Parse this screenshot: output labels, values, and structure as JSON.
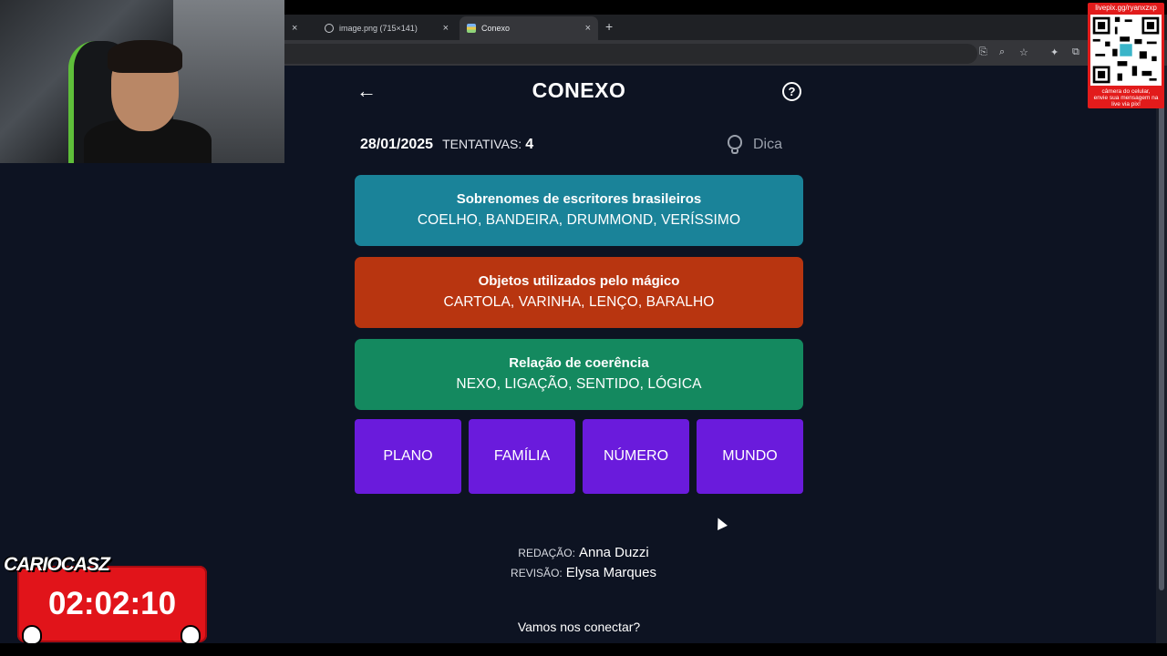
{
  "browser": {
    "tabs": [
      {
        "title": "image.png (715×141)",
        "close": "×"
      },
      {
        "title": "Conexo",
        "close": "×"
      }
    ],
    "first_tab_close": "×",
    "new_tab": "+"
  },
  "game": {
    "back_icon": "arrow-left-icon",
    "title": "CONEXO",
    "help_icon": "?",
    "date": "28/01/2025",
    "attempts_label": "TENTATIVAS:",
    "attempts_value": "4",
    "hint_label": "Dica",
    "groups": [
      {
        "title": "Sobrenomes de escritores brasileiros",
        "words": "COELHO, BANDEIRA, DRUMMOND, VERÍSSIMO",
        "color": "#1a8399"
      },
      {
        "title": "Objetos utilizados pelo mágico",
        "words": "CARTOLA, VARINHA, LENÇO, BARALHO",
        "color": "#b83510"
      },
      {
        "title": "Relação de coerência",
        "words": "NEXO, LIGAÇÃO, SENTIDO, LÓGICA",
        "color": "#14895f"
      }
    ],
    "tiles": [
      "PLANO",
      "FAMÍLIA",
      "NÚMERO",
      "MUNDO"
    ],
    "tile_color": "#6a1bdc",
    "credits": {
      "writing_label": "REDAÇÃO:",
      "writing_value": "Anna Duzzi",
      "review_label": "REVISÃO:",
      "review_value": "Elysa Marques"
    },
    "connect": "Vamos nos conectar?"
  },
  "overlay": {
    "qr_header": "livepix.gg/ryanxzxp",
    "qr_caption_line1": "câmera do celular,",
    "qr_caption_line2": "envie sua mensagem na",
    "qr_caption_line3": "live via pix!",
    "timer_logo": "CARIOCASZ",
    "timer_value": "02:02:10"
  }
}
